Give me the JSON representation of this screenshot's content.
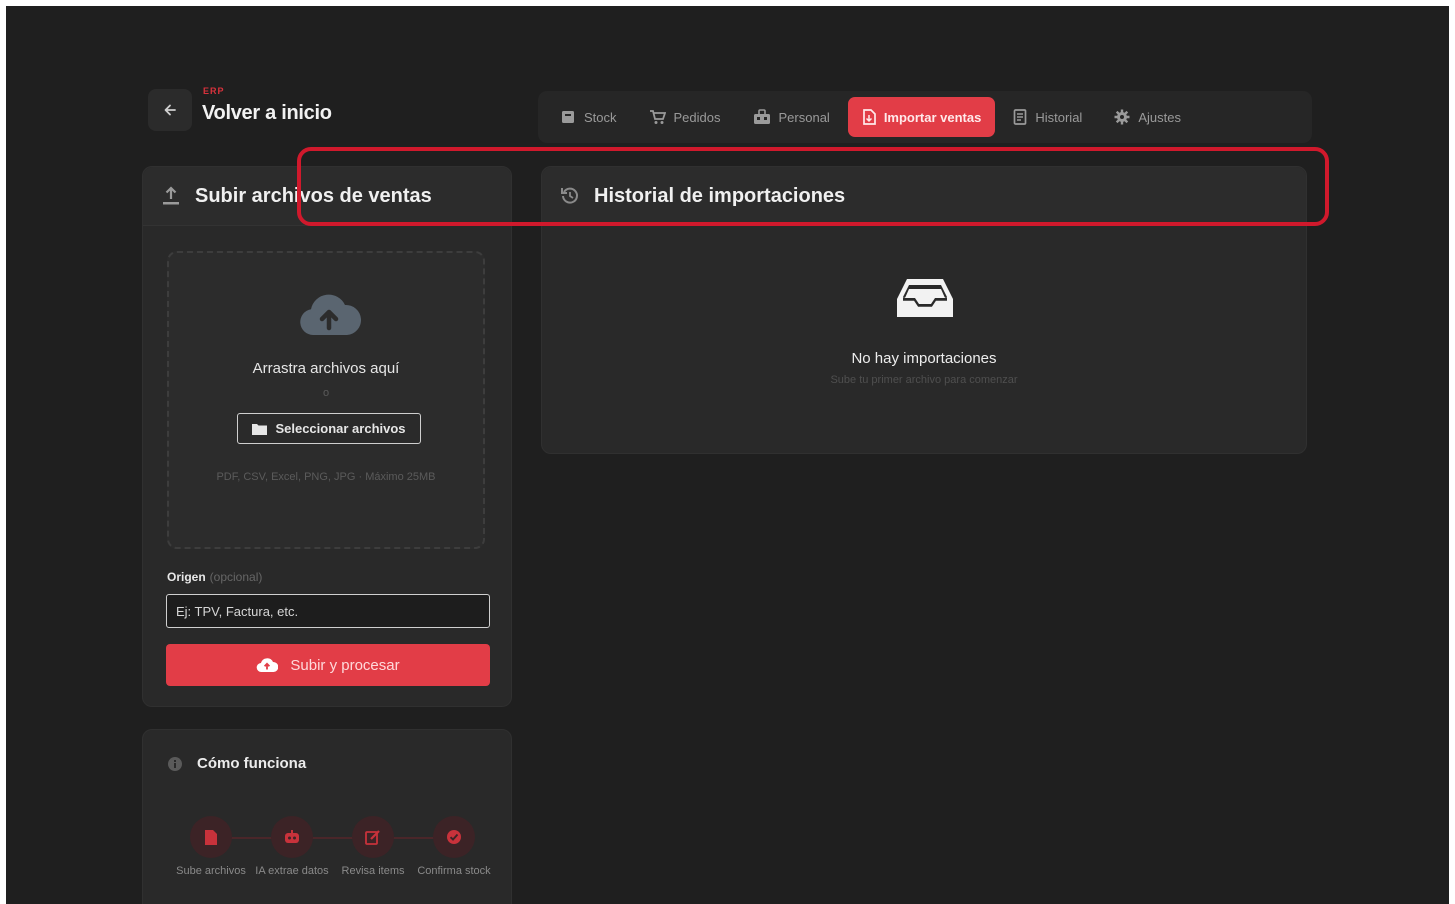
{
  "header": {
    "brand_mark": "ERP",
    "back_label": "Volver a inicio"
  },
  "nav": {
    "tabs": [
      {
        "label": "Stock",
        "icon": "box-icon",
        "active": false
      },
      {
        "label": "Pedidos",
        "icon": "cart-icon",
        "active": false
      },
      {
        "label": "Personal",
        "icon": "team-icon",
        "active": false
      },
      {
        "label": "Importar ventas",
        "icon": "file-import-icon",
        "active": true
      },
      {
        "label": "Historial",
        "icon": "receipt-icon",
        "active": false
      },
      {
        "label": "Ajustes",
        "icon": "gear-icon",
        "active": false
      }
    ]
  },
  "upload": {
    "title": "Subir archivos de ventas",
    "drop_text": "Arrastra archivos aquí",
    "or_text": "o",
    "select_button": "Seleccionar archivos",
    "formats": "PDF, CSV, Excel, PNG, JPG · Máximo 25MB",
    "origin_label": "Origen",
    "origin_optional": "(opcional)",
    "origin_placeholder": "Ej: TPV, Factura, etc.",
    "submit_button": "Subir y procesar"
  },
  "history": {
    "title": "Historial de importaciones",
    "empty_title": "No hay importaciones",
    "empty_subtitle": "Sube tu primer archivo para comenzar"
  },
  "how": {
    "title": "Cómo funciona",
    "steps": [
      {
        "label": "Sube archivos",
        "icon": "file-icon"
      },
      {
        "label": "IA extrae datos",
        "icon": "robot-icon"
      },
      {
        "label": "Revisa items",
        "icon": "edit-icon"
      },
      {
        "label": "Confirma stock",
        "icon": "check-circle-icon"
      }
    ]
  },
  "colors": {
    "accent": "#e23d47",
    "background": "#1f1f1f",
    "panel": "#292929",
    "highlight": "#d0192c"
  }
}
